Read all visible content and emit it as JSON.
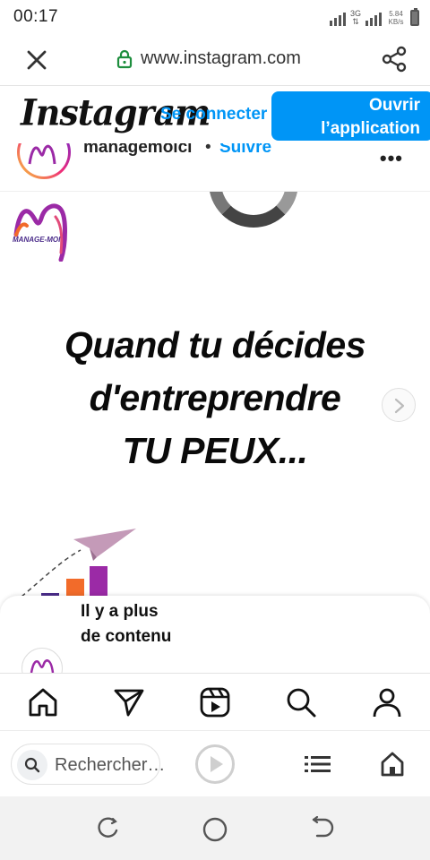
{
  "status_bar": {
    "time": "00:17",
    "network_1": "3G",
    "speed_value": "5.84",
    "speed_unit": "KB/s"
  },
  "browser": {
    "url": "www.instagram.com",
    "icons": {
      "close": "close-icon",
      "lock": "lock-icon",
      "share": "share-icon"
    }
  },
  "ig_header": {
    "logo": "Instagram",
    "login_label": "Se connecter",
    "open_app_label": "Ouvrir l’application"
  },
  "post": {
    "username": "managemoici",
    "separator": "•",
    "follow_label": "Suivre",
    "more_label": "•••",
    "brand_logo_text": "MANAGE-MOI",
    "headline_line1": "Quand tu décides",
    "headline_line2": "d'entreprendre",
    "headline_line3": "TU PEUX..."
  },
  "more_card": {
    "text": "Il y a plus de contenu"
  },
  "ig_nav": {
    "items": [
      "home-icon",
      "send-icon",
      "reels-icon",
      "search-icon",
      "profile-icon"
    ]
  },
  "browser_bottom": {
    "search_placeholder": "Rechercher…",
    "icons": [
      "search-icon",
      "play-icon",
      "list-icon",
      "home-icon"
    ]
  },
  "android_nav": {
    "items": [
      "recents-icon",
      "home-icon",
      "back-icon"
    ]
  },
  "colors": {
    "ig_blue": "#0095f6",
    "text_dark": "#111111",
    "brand_purple": "#9b2aa6",
    "brand_orange": "#f26b2a"
  }
}
